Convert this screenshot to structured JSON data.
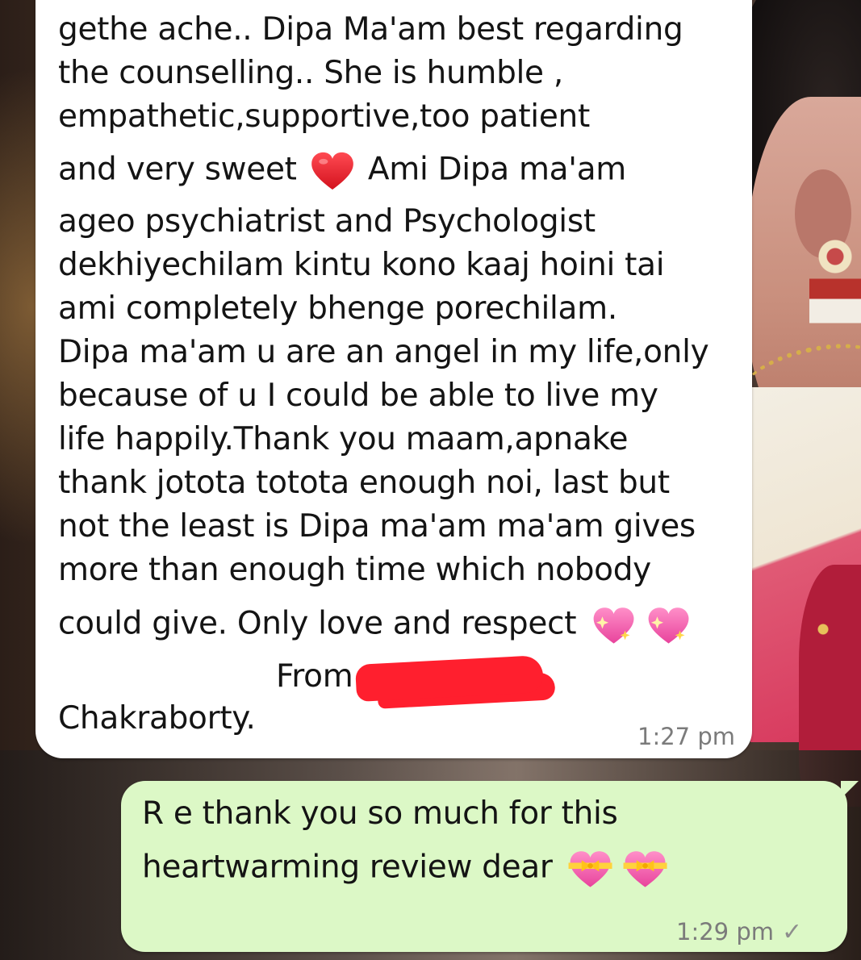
{
  "conversation": {
    "incoming": {
      "lines": [
        "gethe ache.. Dipa Ma'am best regarding",
        "the counselling.. She is humble ,",
        "empathetic,supportive,too patient",
        "and very sweet",
        "Ami Dipa ma'am",
        "ageo psychiatrist and Psychologist",
        "dekhiyechilam kintu kono kaaj hoini tai",
        "ami  completely bhenge porechilam.",
        "Dipa ma'am u are an angel in my life,only",
        "because  of u I could be able to live my",
        "life happily.Thank you maam,apnake",
        "thank jotota totota enough noi, last but",
        "not the least is Dipa ma'am ma'am gives",
        "more than enough time which nobody",
        "could give. Only love and respect",
        "From",
        "Chakraborty."
      ],
      "emojis": [
        "red-heart-icon",
        "sparkling-heart-icon",
        "sparkling-heart-icon"
      ],
      "redacted": true,
      "time": "1:27 pm"
    },
    "outgoing": {
      "lines": [
        "R e thank you so much for this",
        "heartwarming review dear"
      ],
      "emojis": [
        "heart-with-ribbon-icon",
        "heart-with-ribbon-icon"
      ],
      "time": "1:29 pm",
      "status": "sent-tick-icon"
    }
  },
  "colors": {
    "incoming_bubble": "#ffffff",
    "outgoing_bubble": "#dcf8c6",
    "redaction": "#ff1f2e",
    "timestamp": "#7b7b7b"
  }
}
